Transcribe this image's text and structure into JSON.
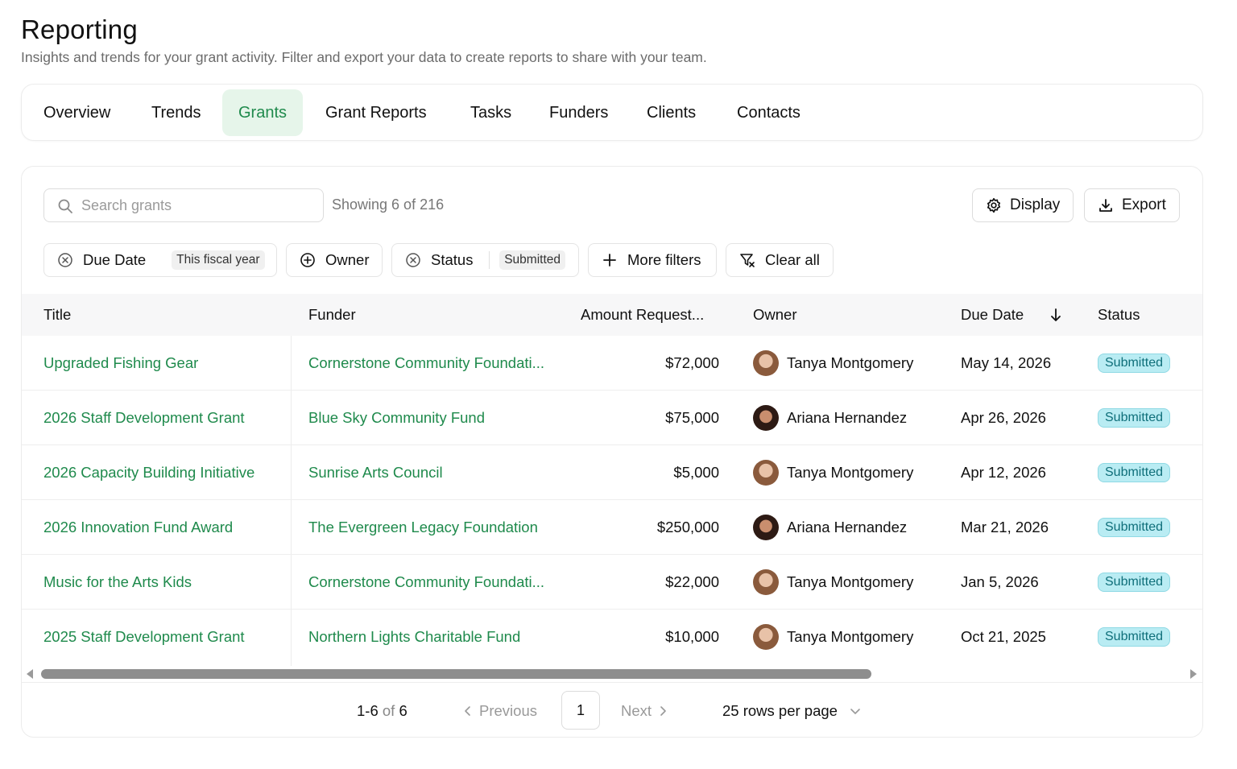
{
  "header": {
    "title": "Reporting",
    "subtitle": "Insights and trends for your grant activity. Filter and export your data to create reports to share with your team."
  },
  "tabs": [
    {
      "label": "Overview",
      "active": false
    },
    {
      "label": "Trends",
      "active": false
    },
    {
      "label": "Grants",
      "active": true
    },
    {
      "label": "Grant Reports",
      "active": false
    },
    {
      "label": "Tasks",
      "active": false
    },
    {
      "label": "Funders",
      "active": false
    },
    {
      "label": "Clients",
      "active": false
    },
    {
      "label": "Contacts",
      "active": false
    }
  ],
  "toolbar": {
    "search_placeholder": "Search grants",
    "search_value": "",
    "showing": "Showing 6 of 216",
    "display_label": "Display",
    "export_label": "Export"
  },
  "filters": {
    "due_date": {
      "label": "Due Date",
      "value": "This fiscal year"
    },
    "owner": {
      "label": "Owner"
    },
    "status": {
      "label": "Status",
      "value": "Submitted"
    },
    "more_filters": "More filters",
    "clear_all": "Clear all"
  },
  "table": {
    "columns": [
      "Title",
      "Funder",
      "Amount Request...",
      "Owner",
      "Due Date",
      "Status"
    ],
    "rows": [
      {
        "title": "Upgraded Fishing Gear",
        "funder": "Cornerstone Community Foundati...",
        "amount": "$72,000",
        "owner": "Tanya Montgomery",
        "due": "May 14, 2026",
        "status": "Submitted"
      },
      {
        "title": "2026 Staff Development Grant",
        "funder": "Blue Sky Community Fund",
        "amount": "$75,000",
        "owner": "Ariana Hernandez",
        "due": "Apr 26, 2026",
        "status": "Submitted"
      },
      {
        "title": "2026 Capacity Building Initiative",
        "funder": "Sunrise Arts Council",
        "amount": "$5,000",
        "owner": "Tanya Montgomery",
        "due": "Apr 12, 2026",
        "status": "Submitted"
      },
      {
        "title": "2026 Innovation Fund Award",
        "funder": "The Evergreen Legacy Foundation",
        "amount": "$250,000",
        "owner": "Ariana Hernandez",
        "due": "Mar 21, 2026",
        "status": "Submitted"
      },
      {
        "title": "Music for the Arts Kids",
        "funder": "Cornerstone Community Foundati...",
        "amount": "$22,000",
        "owner": "Tanya Montgomery",
        "due": "Jan 5, 2026",
        "status": "Submitted"
      },
      {
        "title": "2025 Staff Development Grant",
        "funder": "Northern Lights Charitable Fund",
        "amount": "$10,000",
        "owner": "Tanya Montgomery",
        "due": "Oct 21, 2025",
        "status": "Submitted"
      }
    ]
  },
  "pagination": {
    "range_start": "1-6",
    "range_of": "of",
    "range_total": "6",
    "previous": "Previous",
    "page": "1",
    "next": "Next",
    "rows_per_page": "25 rows per page"
  },
  "colors": {
    "accent_green": "#1f8a4c",
    "active_tab_bg": "#e6f5ea",
    "status_badge_bg": "#b9ecf3",
    "status_badge_text": "#0f6f7a"
  }
}
